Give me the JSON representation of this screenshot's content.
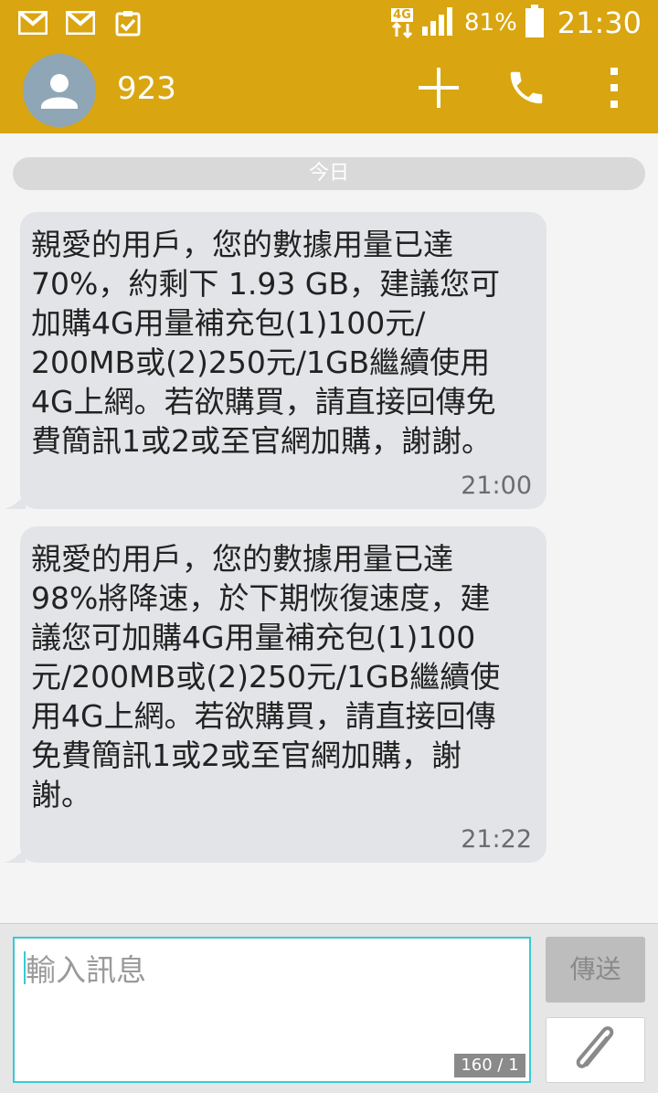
{
  "status_bar": {
    "notifications": [
      "gmail-icon",
      "gmail-icon",
      "clipboard-check-icon"
    ],
    "network": "4G",
    "battery": "81%",
    "time": "21:30"
  },
  "app_bar": {
    "contact_name": "923",
    "icons": [
      "avatar-person-icon",
      "add-icon",
      "phone-icon",
      "more-vert-icon"
    ]
  },
  "conversation": {
    "date_divider": "今日",
    "messages": [
      {
        "text": "親愛的用戶，您的數據用量已達\n70%，約剩下 1.93 GB，建議您可\n加購4G用量補充包(1)100元/\n200MB或(2)250元/1GB繼續使用\n4G上網。若欲購買，請直接回傳免\n費簡訊1或2或至官網加購，謝謝。",
        "time": "21:00"
      },
      {
        "text": "親愛的用戶，您的數據用量已達\n98%將降速，於下期恢復速度，建\n議您可加購4G用量補充包(1)100\n元/200MB或(2)250元/1GB繼續使\n用4G上網。若欲購買，請直接回傳\n免費簡訊1或2或至官網加購，謝\n謝。",
        "time": "21:22"
      }
    ]
  },
  "composer": {
    "placeholder": "輸入訊息",
    "counter": "160 / 1",
    "send_label": "傳送",
    "attach_icon": "paperclip-icon"
  },
  "colors": {
    "accent": "#d9a510",
    "bubble": "#e2e4e7",
    "input_border": "#38cad3"
  }
}
